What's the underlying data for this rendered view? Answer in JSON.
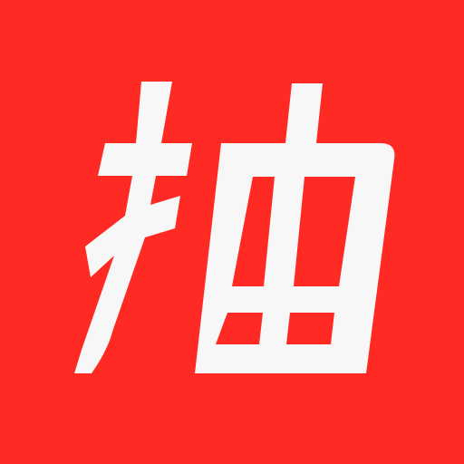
{
  "app_icon": {
    "glyph": "抽",
    "icon_name": "chou-character-app-icon",
    "colors": {
      "background": "#FF2A24",
      "glyph": "#F7F7F7"
    }
  }
}
